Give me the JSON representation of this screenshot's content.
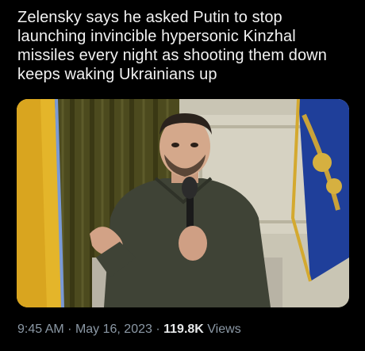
{
  "tweet": {
    "text_lines": [
      "Zelensky says he asked Putin to stop",
      "launching invincible hypersonic Kinzhal",
      "missiles every night as shooting them down",
      "keeps waking Ukrainians up"
    ]
  },
  "media": {
    "icon": "photo-of-speaker-with-microphone",
    "colors": {
      "flag_yellow": "#e4b52a",
      "flag_blue": "#1f3f9a",
      "curtain": "#4c4a1e",
      "wall": "#c9c5b4"
    }
  },
  "meta": {
    "time": "9:45 AM",
    "separator": "·",
    "date": "May 16, 2023",
    "views_count": "119.8K",
    "views_label": "Views"
  }
}
